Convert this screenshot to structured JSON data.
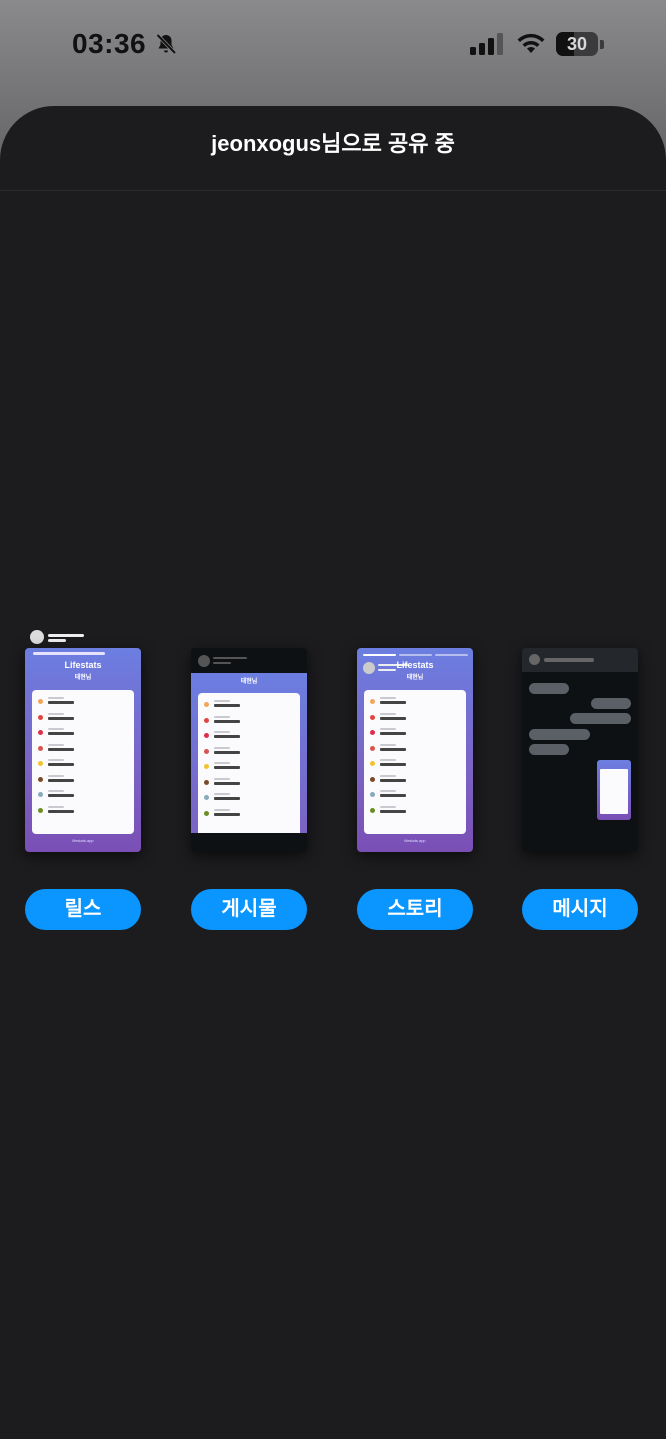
{
  "status_bar": {
    "time": "03:36",
    "battery": "30"
  },
  "sheet": {
    "title": "jeonxogus님으로 공유 중"
  },
  "preview": {
    "app_title": "Lifestats",
    "user": "태현님",
    "footer": "lifestats.app"
  },
  "options": [
    {
      "label": "릴스"
    },
    {
      "label": "게시물"
    },
    {
      "label": "스토리"
    },
    {
      "label": "메시지"
    }
  ],
  "colors": {
    "accent": "#0a95ff",
    "sheet": "#1c1c1e",
    "thumb_top": "#6c7ee1",
    "thumb_bottom": "#7a4fb5"
  }
}
